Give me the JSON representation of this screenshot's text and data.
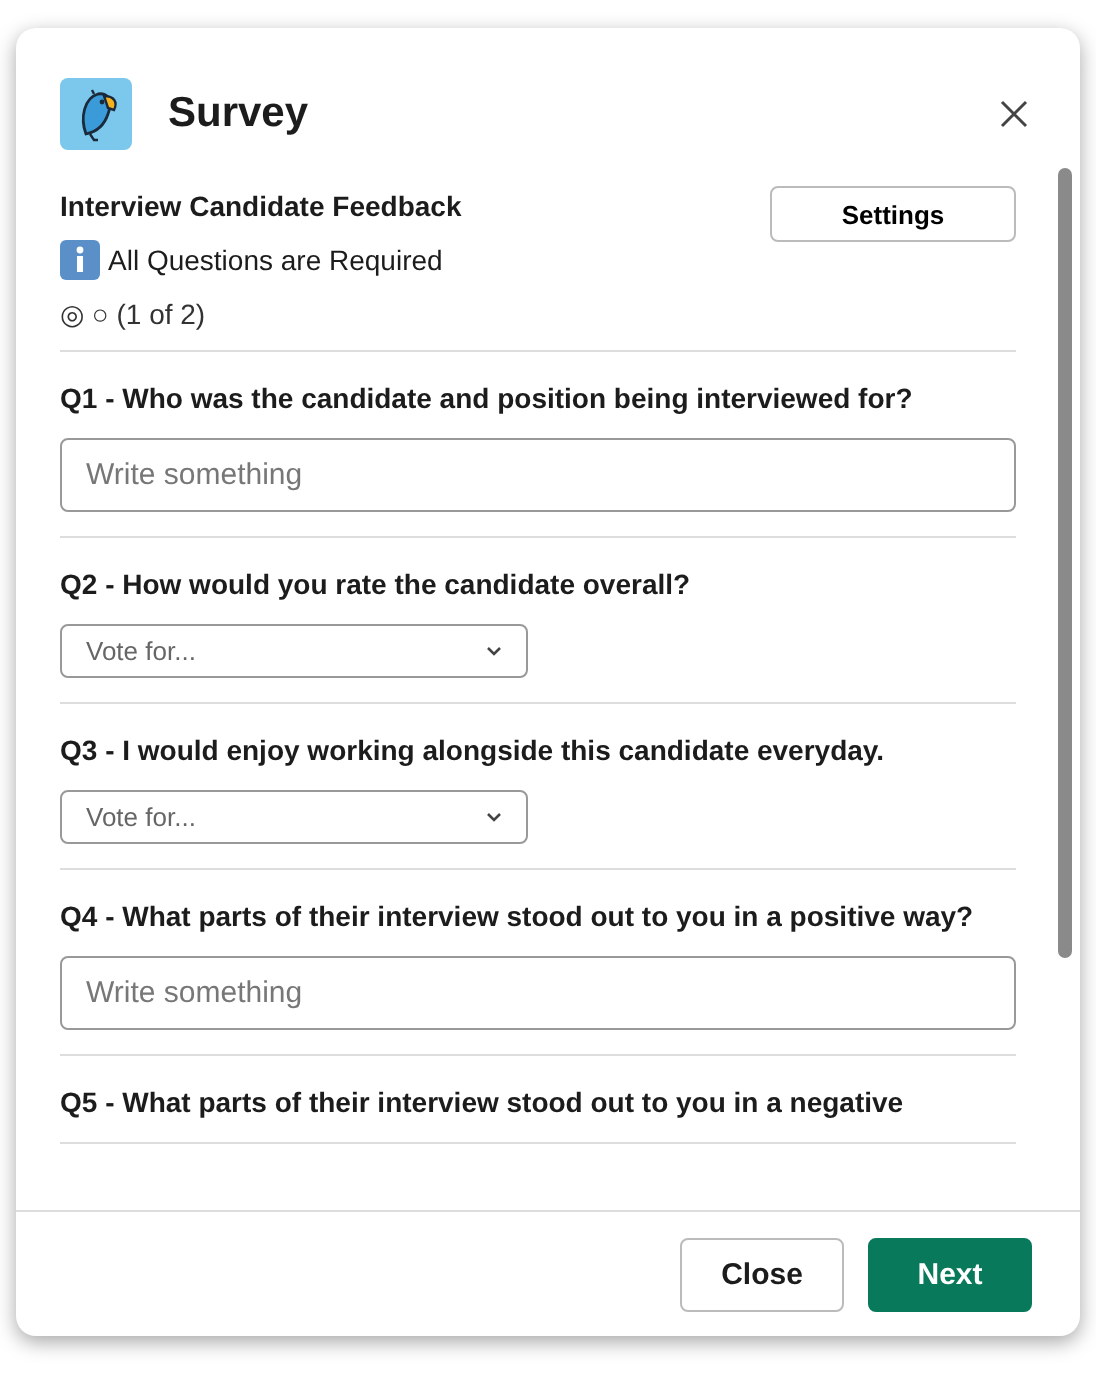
{
  "window": {
    "title": "Survey"
  },
  "survey": {
    "title": "Interview Candidate Feedback",
    "settings_button": "Settings",
    "notice": "All Questions are Required",
    "progress": "◎ ○ (1 of 2)"
  },
  "questions": [
    {
      "kind": "text",
      "label": "Q1 - Who was the candidate and position being interviewed for?",
      "placeholder": "Write something"
    },
    {
      "kind": "select",
      "label": "Q2 - How would you rate the candidate overall?",
      "placeholder": "Vote for..."
    },
    {
      "kind": "select",
      "label": "Q3 - I would enjoy working alongside this candidate everyday.",
      "placeholder": "Vote for..."
    },
    {
      "kind": "text",
      "label": "Q4 - What parts of their interview stood out to you in a positive way?",
      "placeholder": "Write something"
    },
    {
      "kind": "title",
      "label": "Q5 - What parts of their interview stood out to you in a negative"
    }
  ],
  "buttons": [
    {
      "label": "Close",
      "kind": "secondary"
    },
    {
      "label": "Next",
      "kind": "primary"
    }
  ]
}
